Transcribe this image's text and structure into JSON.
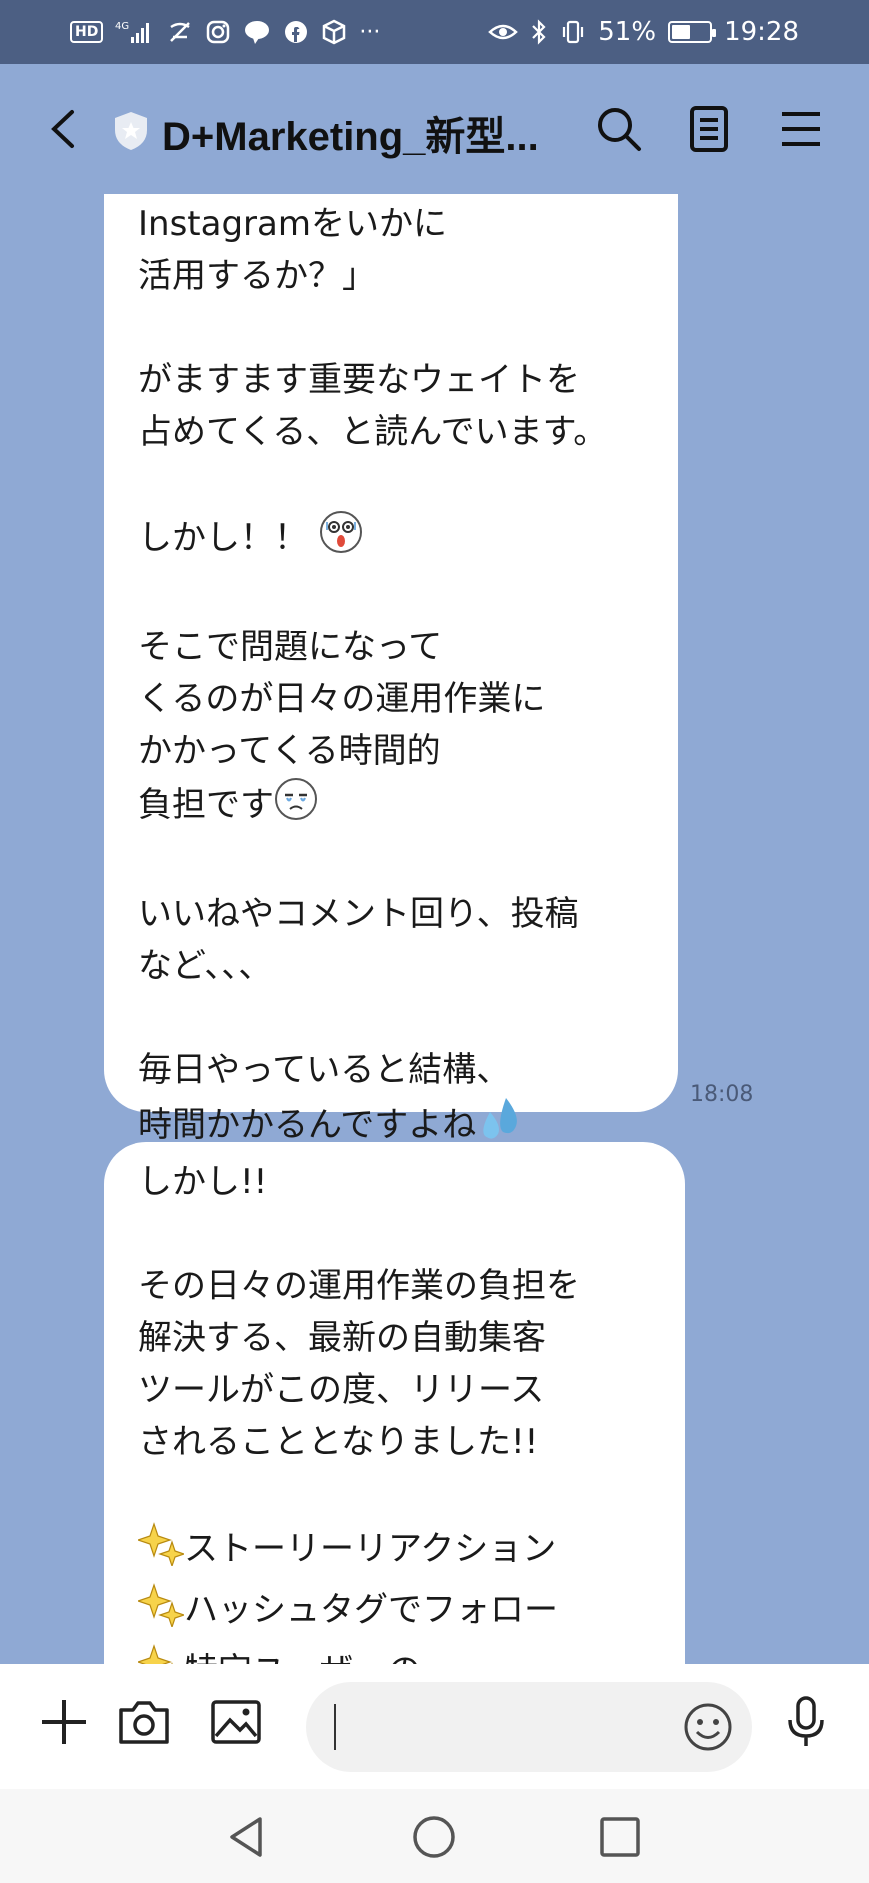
{
  "status_bar": {
    "network": "4G",
    "battery_percent": "51%",
    "battery_level": 0.51,
    "time": "19:28"
  },
  "header": {
    "title": "D+Marketing_新型..."
  },
  "messages": [
    {
      "lines": [
        "Instagramをいかに",
        "活用するか？」",
        "",
        "がますます重要なウェイトを",
        "占めてくる、と読んでいます。",
        "",
        "しかし！！",
        "",
        "そこで問題になって",
        "くるのが日々の運用作業に",
        "かかってくる時間的",
        "負担です",
        "",
        "いいねやコメント回り、投稿",
        "など、、、",
        "",
        "毎日やっていると結構、",
        "時間かかるんですよね"
      ],
      "time": "18:08"
    },
    {
      "lines": [
        "しかし!!",
        "",
        "その日々の運用作業の負担を",
        "解決する、最新の自動集客",
        "ツールがこの度、リリース",
        "されることとなりました!!",
        "",
        "ストーリーリアクション",
        "ハッシュタグでフォロー",
        "特定ユーザーの"
      ]
    }
  ],
  "icons": {
    "shocked_emoji": "shocked-face-icon",
    "crying_emoji": "crying-face-icon",
    "sweat_emoji": "sweat-drop-icon",
    "sparkle_emoji": "sparkles-icon"
  }
}
